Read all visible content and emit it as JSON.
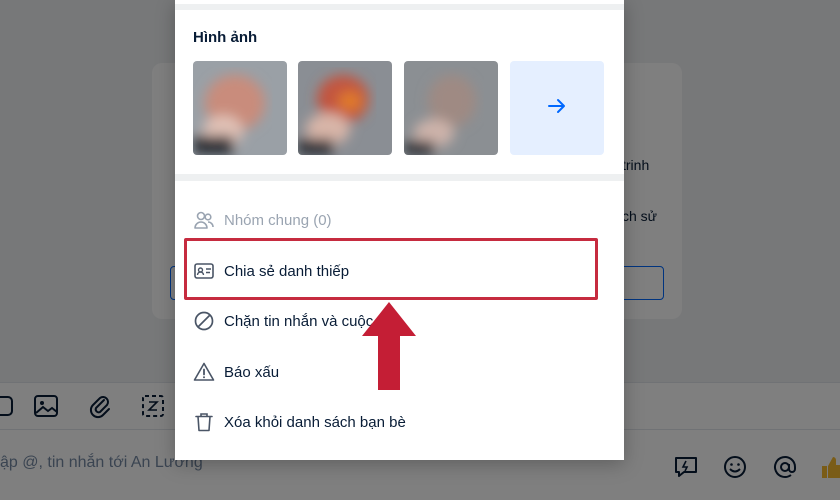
{
  "background": {
    "card_lines": [
      "trinh",
      "ch sử"
    ],
    "compose_placeholder": "ập @, tin nhắn tới An Lương",
    "toolbar_icons": [
      "sticker-icon",
      "image-icon",
      "attachment-icon",
      "screenshot-icon"
    ],
    "compose_icons": [
      "quick-message-icon",
      "emoji-icon",
      "mention-icon",
      "like-icon"
    ]
  },
  "panel": {
    "media_section_title": "Hình ảnh",
    "media_thumbs": [
      {
        "color_a": "#c98c7b",
        "color_b": "#9aa0a6"
      },
      {
        "color_a": "#c2553f",
        "color_b": "#8a8e94"
      },
      {
        "color_a": "#9f8a83",
        "color_b": "#8b8f93"
      }
    ],
    "more_media_icon": "arrow-right-icon",
    "menu_items": [
      {
        "label": "Nhóm chung (0)",
        "icon": "group-icon",
        "disabled": true
      },
      {
        "label": "Chia sẻ danh thiếp",
        "icon": "contact-card-icon",
        "disabled": false
      },
      {
        "label": "Chặn tin nhắn và cuộc gọi",
        "icon": "block-icon",
        "disabled": false
      },
      {
        "label": "Báo xấu",
        "icon": "warning-icon",
        "disabled": false
      },
      {
        "label": "Xóa khỏi danh sách bạn bè",
        "icon": "trash-icon",
        "disabled": false
      }
    ]
  },
  "annotation": {
    "highlight_color": "#c62b3f",
    "arrow_color": "#c41e35"
  }
}
